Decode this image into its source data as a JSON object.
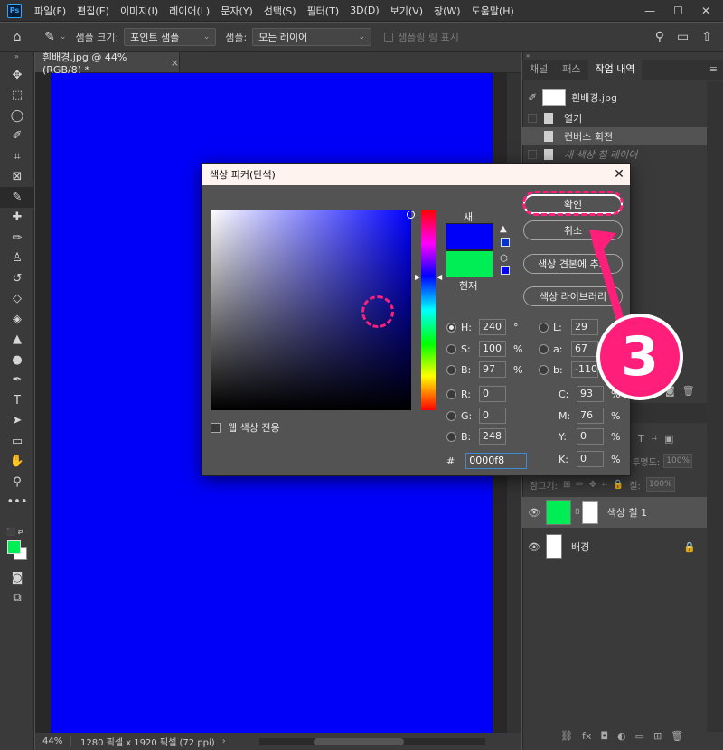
{
  "menubar": {
    "logo": "Ps",
    "items": [
      "파일(F)",
      "편집(E)",
      "이미지(I)",
      "레이어(L)",
      "문자(Y)",
      "선택(S)",
      "필터(T)",
      "3D(D)",
      "보기(V)",
      "창(W)",
      "도움말(H)"
    ],
    "window_buttons": [
      "—",
      "☐",
      "✕"
    ]
  },
  "options": {
    "sample_size_label": "샘플 크기:",
    "sample_size_value": "포인트 샘플",
    "sample_label": "샘플:",
    "sample_value": "모든 레이어",
    "show_ring_label": "샘플링 링 표시"
  },
  "document": {
    "tab_title": "흰배경.jpg @ 44% (RGB/8) *",
    "tab_close": "×",
    "canvas_color": "#0000f8",
    "zoom": "44%",
    "info": "1280 픽셀 x 1920 픽셀 (72 ppi)"
  },
  "history_panel": {
    "tabs": [
      "채널",
      "패스",
      "작업 내역"
    ],
    "active_tab": "작업 내역",
    "snapshot": "흰배경.jpg",
    "items": [
      "열기",
      "컨버스 회전",
      "새 색상 칠 레이어"
    ]
  },
  "layers_panel": {
    "opacity_label": "불투명도:",
    "opacity_value": "100%",
    "lock_label": "잠그기:",
    "fill_label": "칠:",
    "fill_value": "100%",
    "layers": [
      {
        "name": "색상 칠 1",
        "thumb_color": "#00ee55"
      },
      {
        "name": "배경",
        "thumb_color": "#ffffff"
      }
    ]
  },
  "color_picker": {
    "title": "색상 피커(단색)",
    "close": "✕",
    "new_label": "새",
    "current_label": "현재",
    "new_color": "#0000f8",
    "current_color": "#00ee55",
    "web_only_label": "웹 색상 전용",
    "buttons": {
      "ok": "확인",
      "cancel": "취소",
      "add_swatch": "색상 견본에 추가",
      "libraries": "색상 라이브러리"
    },
    "hsb": {
      "h": {
        "label": "H:",
        "value": "240",
        "unit": "°"
      },
      "s": {
        "label": "S:",
        "value": "100",
        "unit": "%"
      },
      "b": {
        "label": "B:",
        "value": "97",
        "unit": "%"
      }
    },
    "rgb": {
      "r": {
        "label": "R:",
        "value": "0"
      },
      "g": {
        "label": "G:",
        "value": "0"
      },
      "b": {
        "label": "B:",
        "value": "248"
      }
    },
    "lab": {
      "l": {
        "label": "L:",
        "value": "29"
      },
      "a": {
        "label": "a:",
        "value": "67"
      },
      "b": {
        "label": "b:",
        "value": "-110"
      }
    },
    "cmyk": {
      "c": {
        "label": "C:",
        "value": "93",
        "unit": "%"
      },
      "m": {
        "label": "M:",
        "value": "76",
        "unit": "%"
      },
      "y": {
        "label": "Y:",
        "value": "0",
        "unit": "%"
      },
      "k": {
        "label": "K:",
        "value": "0",
        "unit": "%"
      }
    },
    "hex_label": "#",
    "hex_value": "0000f8"
  },
  "annotation": {
    "step_number": "3",
    "color": "#ff1f7a"
  }
}
